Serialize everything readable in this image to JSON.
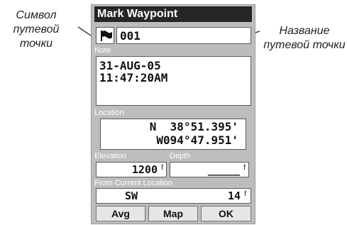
{
  "callouts": {
    "left": {
      "line1": "Символ",
      "line2": "путевой",
      "line3": "точки"
    },
    "right": {
      "line1": "Название",
      "line2": "путевой точки"
    }
  },
  "device": {
    "title": "Mark Waypoint",
    "waypoint": {
      "icon": "flag-icon",
      "name": "001"
    },
    "note": {
      "label": "Note",
      "line1": "31-AUG-05",
      "line2": "11:47:20AM"
    },
    "location": {
      "label": "Location",
      "lat": "N  38°51.395'",
      "lon": "W094°47.951'"
    },
    "elevation": {
      "label": "Elevation",
      "value": "1200",
      "unit": "f"
    },
    "depth": {
      "label": "Depth",
      "value": "_____",
      "unit": "f"
    },
    "from_current": {
      "label": "From Current Location",
      "bearing": "SW",
      "distance": "14",
      "distance_unit": "f"
    },
    "buttons": {
      "avg": "Avg",
      "map": "Map",
      "ok": "OK"
    }
  },
  "colors": {
    "titlebar": "#262626",
    "panel": "#bdbdbd",
    "box": "#ffffff"
  }
}
